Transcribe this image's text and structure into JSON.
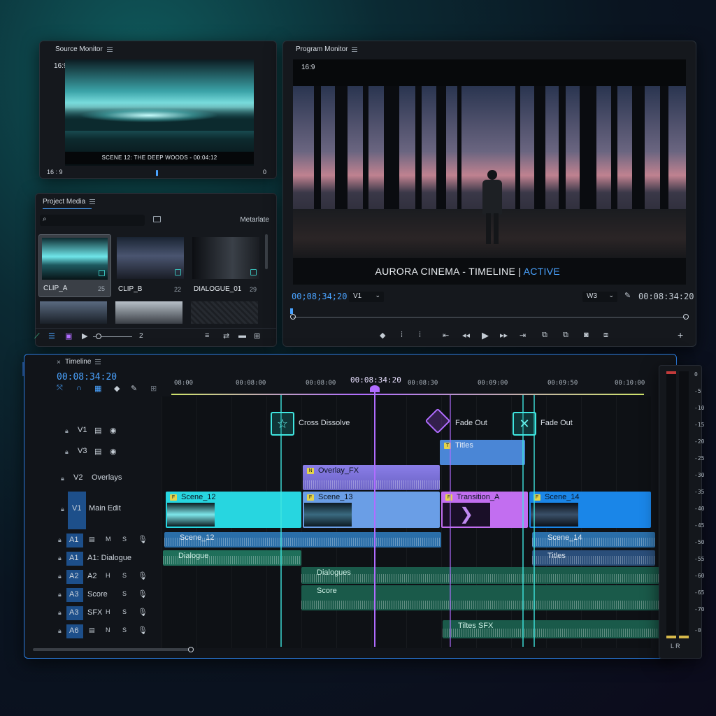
{
  "source_monitor": {
    "title": "Source Monitor",
    "aspect_top": "16:9",
    "aspect_bottom": "16 : 9",
    "caption": "SCENE 12: THE DEEP WOODS - 00:04:12",
    "counter": "0"
  },
  "project_media": {
    "title": "Project Media",
    "metadata_label": "Metarlate",
    "items": [
      {
        "name": "CLIP_A",
        "num": "25"
      },
      {
        "name": "CLIP_B",
        "num": "22"
      },
      {
        "name": "DIALOGUE_01",
        "num": "29"
      }
    ],
    "zoom_value": "2"
  },
  "program_monitor": {
    "title": "Program Monitor",
    "aspect": "16:9",
    "caption_main": "AURORA CINEMA - TIMELINE | ",
    "caption_active": "ACTIVE",
    "timecode_left": "00;08;34;20",
    "track_select": "V1",
    "timecode_right": "00:08:34:20",
    "audio_select": "W3",
    "add_label": "+"
  },
  "timeline": {
    "title": "Timeline",
    "timecode": "00:08:34:20",
    "playhead_time": "00:08:34:20",
    "ruler": [
      "08:00",
      "00:08:00",
      "00:08:00",
      "00:08:30",
      "00:09:00",
      "00:09:50",
      "00:10:00"
    ],
    "markers": [
      {
        "label": "Cross Dissolve",
        "icon": "star-icon"
      },
      {
        "label": "Fade Out",
        "icon": "diamond-icon"
      },
      {
        "label": "Fade Out",
        "icon": "cross-icon"
      }
    ],
    "tracks": [
      {
        "id": "V1",
        "name": ""
      },
      {
        "id": "V3",
        "name": ""
      },
      {
        "id": "V2",
        "name": "Overlays"
      },
      {
        "id": "V1",
        "name": "Main Edit"
      },
      {
        "id": "A1",
        "name": "",
        "m": "M",
        "s": "S"
      },
      {
        "id": "A1",
        "name": "A1: Dialogue"
      },
      {
        "id": "A2",
        "name": "A2",
        "m": "H",
        "s": "S"
      },
      {
        "id": "A3",
        "name": "Score",
        "s": "S"
      },
      {
        "id": "A3",
        "name": "SFX",
        "m": "H",
        "s": "S"
      },
      {
        "id": "A6",
        "name": "",
        "m": "N",
        "s": "S"
      }
    ],
    "clips": {
      "titles": "Titles",
      "overlay_fx": "Overlay_FX",
      "scene_12": "Scene_12",
      "scene_13": "Scene_13",
      "transition_a": "Transition_A",
      "scene_14": "Scene_14",
      "audio_scene_12": "Scene_12",
      "audio_scene_14": "Scene_14",
      "dialogue": "Dialogue",
      "titles_audio": "Titles",
      "dialogue_2": "Dialogues",
      "score": "Score",
      "titles_sfx": "Tiltes SFX"
    }
  },
  "meter": {
    "scale": [
      "0",
      "-5",
      "-10",
      "-15",
      "-20",
      "-25",
      "-30",
      "-35",
      "-40",
      "-45",
      "-50",
      "-55",
      "-60",
      "-65",
      "-70",
      "-0"
    ],
    "bottom_labels": "L R"
  },
  "colors": {
    "accent_blue": "#4aa3ff",
    "teal": "#3fe6e0",
    "purple": "#b06cff",
    "video_clip": "#27d6e0",
    "audio_green": "#1f6f5a"
  }
}
